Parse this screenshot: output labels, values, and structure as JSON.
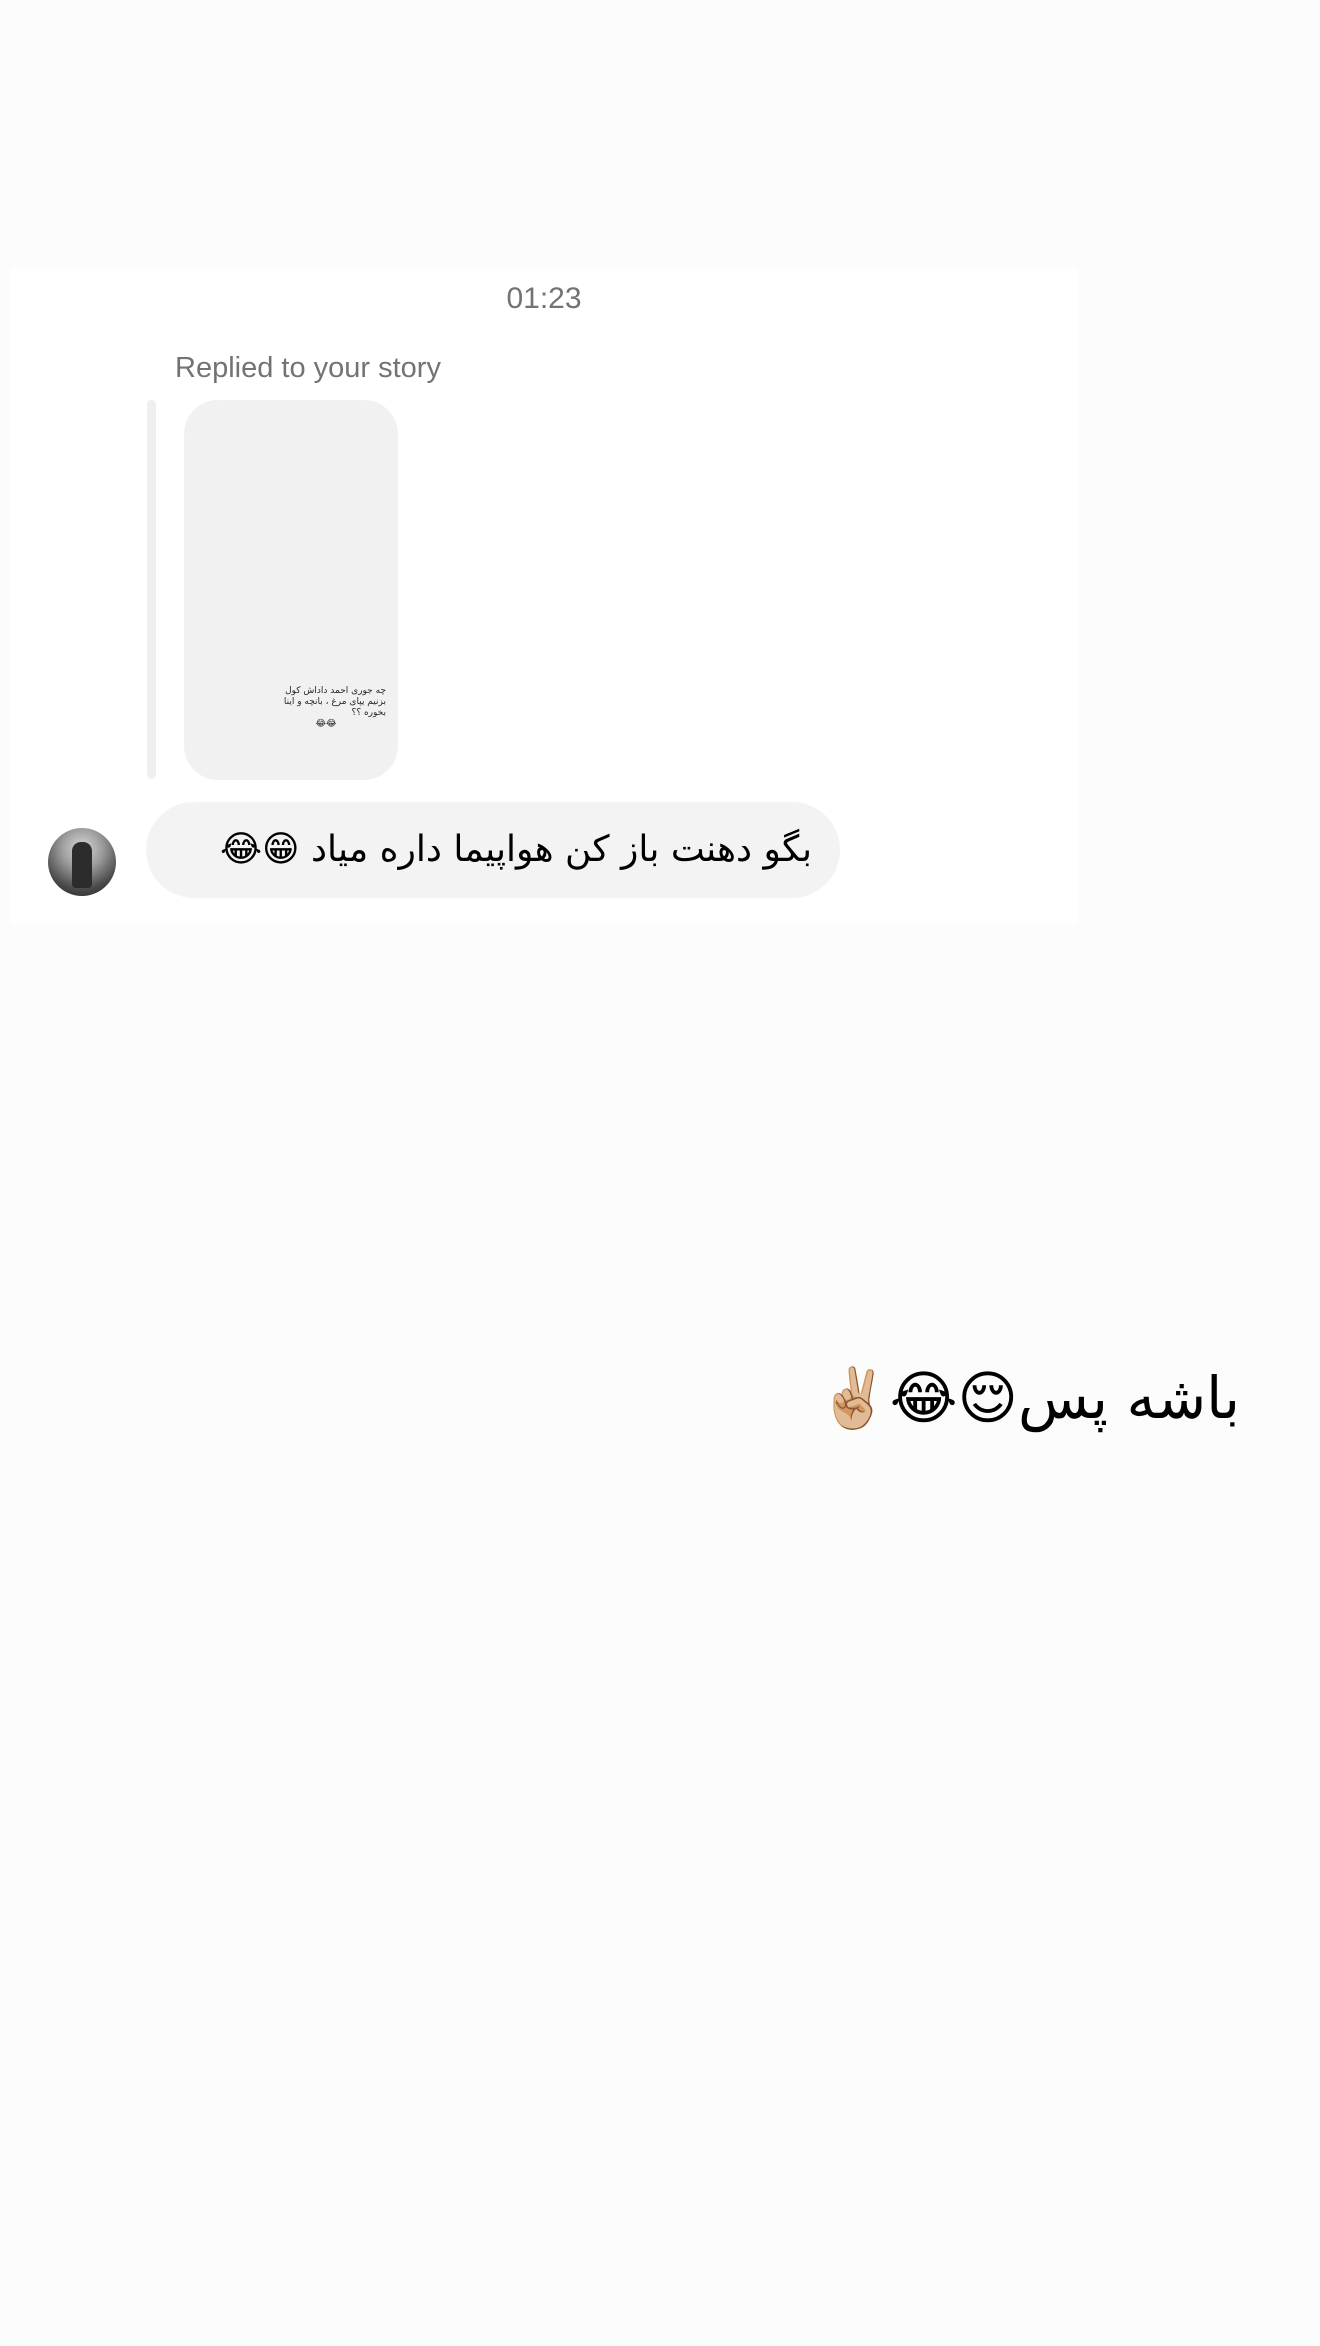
{
  "conversation": {
    "timestamp": "01:23",
    "story_reply": {
      "label": "Replied to your story",
      "story_text": "چه جوری احمد داداش کول بزنیم یپای مرغ ، بانچه و اینا بخوره ؟؟",
      "story_emoji": "😂😂"
    },
    "incoming_message": {
      "text": "بگو دهنت باز کن هواپیما داره میاد 😁😂"
    },
    "outgoing_message": {
      "text": "باشه پس😌😂✌🏼"
    }
  },
  "colors": {
    "page_background": "#fcfcfc",
    "card_background": "#ffffff",
    "muted_text": "#737373",
    "bubble_background": "#f3f3f3",
    "story_background": "#f1f1f1"
  }
}
